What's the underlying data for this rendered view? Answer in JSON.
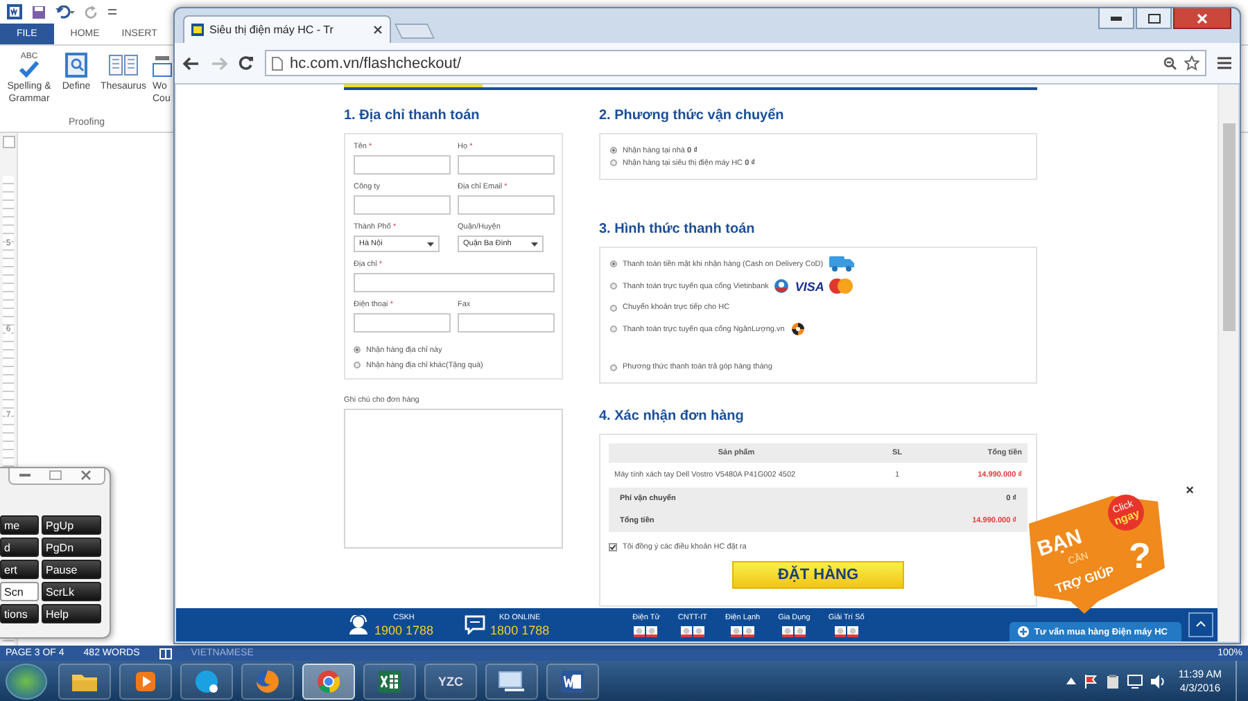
{
  "word": {
    "ribbon_tabs": [
      {
        "label": "FILE",
        "kind": "file"
      },
      {
        "label": "HOME",
        "kind": "tab"
      },
      {
        "label": "INSERT",
        "kind": "tab"
      }
    ],
    "tools": [
      {
        "label": "Spelling & Grammar",
        "kind": "spelling",
        "badge": "ABC"
      },
      {
        "label": "Define",
        "kind": "define"
      },
      {
        "label": "Thesaurus",
        "kind": "thesaurus"
      },
      {
        "label": "Wo Cou",
        "kind": "count"
      }
    ],
    "group_label": "Proofing",
    "ruler_numbers": [
      "5",
      "6",
      "7"
    ],
    "status_bar": {
      "page": "PAGE 3 OF 4",
      "words": "482 WORDS",
      "language": "VIETNAMESE",
      "zoom": "100%"
    }
  },
  "keypad": {
    "keys": [
      {
        "label": "me",
        "pressed": false
      },
      {
        "label": "PgUp",
        "pressed": false
      },
      {
        "label": "d",
        "pressed": false
      },
      {
        "label": "PgDn",
        "pressed": false
      },
      {
        "label": "ert",
        "pressed": false
      },
      {
        "label": "Pause",
        "pressed": false
      },
      {
        "label": "Scn",
        "pressed": true
      },
      {
        "label": "ScrLk",
        "pressed": false
      },
      {
        "label": "tions",
        "pressed": false
      },
      {
        "label": "Help",
        "pressed": false
      }
    ]
  },
  "browser": {
    "tab_title": "Siêu thị điện máy HC - Tr",
    "url": "hc.com.vn/flashcheckout/"
  },
  "checkout": {
    "billing": {
      "title": "1. Địa chỉ thanh toán",
      "fields": [
        {
          "label": "Tên",
          "required_mark": "*",
          "kind": "text"
        },
        {
          "label": "Họ",
          "required_mark": "*",
          "kind": "text"
        },
        {
          "label": "Công ty",
          "kind": "text"
        },
        {
          "label": "Địa chỉ Email",
          "required_mark": "*",
          "kind": "text"
        },
        {
          "label": "Thành Phố",
          "required_mark": "*",
          "kind": "select",
          "value": "Hà Nội"
        },
        {
          "label": "Quận/Huyện",
          "kind": "select",
          "value": "Quận Ba Đình"
        },
        {
          "label": "Địa chỉ",
          "required_mark": "*",
          "kind": "wide"
        },
        {
          "label": "Điện thoại",
          "required_mark": "*",
          "kind": "text"
        },
        {
          "label": "Fax",
          "kind": "text"
        }
      ],
      "delivery_options": [
        {
          "label": "Nhận hàng địa chỉ này",
          "selected": true
        },
        {
          "label": "Nhận hàng địa chỉ khác(Tặng quà)",
          "selected": false
        }
      ],
      "notes_label": "Ghi chú cho đơn hàng"
    },
    "shipping": {
      "title": "2. Phương thức vận chuyển",
      "options": [
        {
          "label": "Nhận hàng tại nhà **0 ₫**",
          "selected": true
        },
        {
          "label": "Nhận hàng tại siêu thị điện máy HC **0 ₫**",
          "selected": false
        }
      ]
    },
    "payment": {
      "title": "3. Hình thức thanh toán",
      "options": [
        {
          "label": "Thanh toán tiền mặt khi nhận hàng (Cash on Delivery CoD)",
          "selected": true,
          "kind": "cod"
        },
        {
          "label": "Thanh toán trực tuyến qua cổng Vietinbank",
          "selected": false,
          "kind": "card",
          "card_text": "VISA"
        },
        {
          "label": "Chuyển khoản trực tiếp cho HC",
          "selected": false,
          "kind": "plain"
        },
        {
          "label": "Thanh toán trực tuyến qua cổng NgânLượng.vn",
          "selected": false,
          "kind": "wallet"
        },
        {
          "label": "Phương thức thanh toán trả góp hàng tháng",
          "selected": false,
          "kind": "installment"
        }
      ]
    },
    "order": {
      "title": "4. Xác nhận đơn hàng",
      "columns": [
        "Sản phẩm",
        "SL",
        "Tổng tiền"
      ],
      "rows": [
        {
          "product": "Máy tính xách tay Dell Vostro V5480A P41G002 4502",
          "qty": "1",
          "total": "14.990.000 ₫"
        }
      ],
      "shipping_fee": {
        "label": "Phí vận chuyển",
        "value": "0 ₫"
      },
      "grand_total": {
        "label": "Tổng tiền",
        "value": "14.990.000 ₫"
      },
      "agree": {
        "label": "Tôi đồng ý các điều khoản HC đặt ra",
        "checked": true
      },
      "submit": "ĐẶT HÀNG"
    }
  },
  "help_badge": {
    "close": "×",
    "click": "Click",
    "now": "ngay",
    "line_1": "BẠN",
    "line_2": "CẦN",
    "line_3": "TRỢ GIÚP",
    "mark": "?"
  },
  "footer": {
    "contacts": [
      {
        "kind": "headset",
        "label": "CSKH",
        "phone": "1900 1788"
      },
      {
        "kind": "chat",
        "label": "KD ONLINE",
        "phone": "1800 1788"
      }
    ],
    "categories": [
      "Điện Tử",
      "CNTT-IT",
      "Điện Lạnh",
      "Gia Dụng",
      "Giải Trí Số"
    ],
    "chat_button": "Tư vấn mua hàng Điện máy HC"
  },
  "taskbar": {
    "apps": [
      {
        "kind": "folder",
        "selected": false
      },
      {
        "kind": "player",
        "selected": false
      },
      {
        "kind": "skype",
        "selected": false
      },
      {
        "kind": "firefox",
        "selected": false
      },
      {
        "kind": "chrome",
        "selected": true
      },
      {
        "kind": "excel",
        "selected": false
      },
      {
        "kind": "text",
        "label": "YZC",
        "selected": false
      },
      {
        "kind": "network",
        "selected": false
      },
      {
        "kind": "word",
        "selected": false
      }
    ],
    "time": "11:39 AM",
    "date": "4/3/2016"
  }
}
